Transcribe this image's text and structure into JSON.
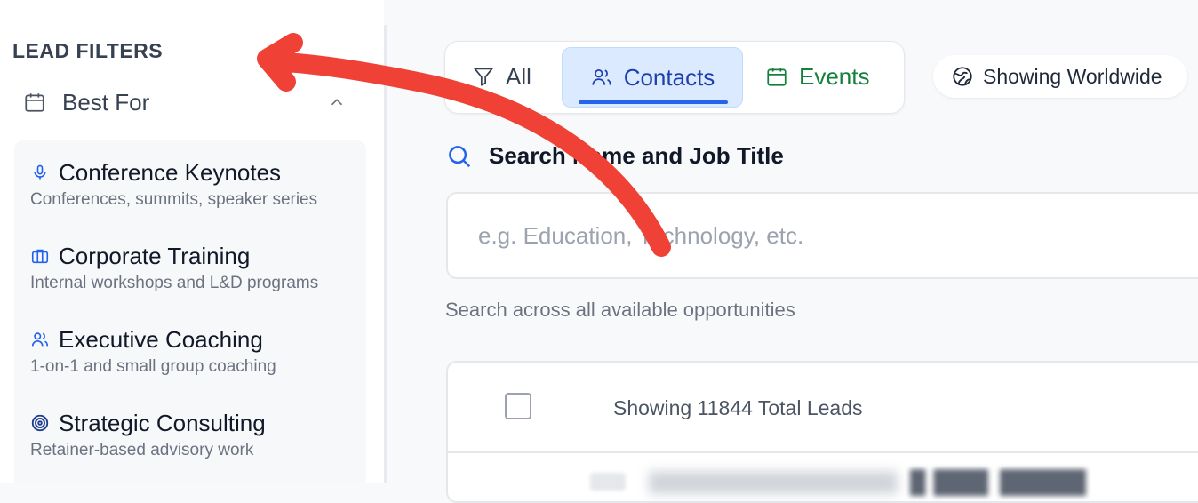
{
  "sidebar": {
    "title": "LEAD FILTERS",
    "section": {
      "label": "Best For",
      "icon": "calendar-icon",
      "toggle_icon": "chevron-up-icon"
    },
    "options": [
      {
        "icon": "microphone-icon",
        "title": "Conference Keynotes",
        "description": "Conferences, summits, speaker series"
      },
      {
        "icon": "briefcase-icon",
        "title": "Corporate Training",
        "description": "Internal workshops and L&D programs"
      },
      {
        "icon": "users-icon",
        "title": "Executive Coaching",
        "description": "1-on-1 and small group coaching"
      },
      {
        "icon": "target-icon",
        "title": "Strategic Consulting",
        "description": "Retainer-based advisory work"
      }
    ]
  },
  "tabs": {
    "all": {
      "label": "All",
      "icon": "filter-icon"
    },
    "contacts": {
      "label": "Contacts",
      "icon": "users-icon",
      "active": true
    },
    "events": {
      "label": "Events",
      "icon": "calendar-icon"
    }
  },
  "location": {
    "label": "Showing Worldwide",
    "icon": "globe-icon"
  },
  "search": {
    "heading": "Search Name and Job Title",
    "placeholder": "e.g. Education, Technology, etc.",
    "hint": "Search across all available opportunities"
  },
  "table": {
    "lead_count_label": "Showing 11844 Total Leads"
  },
  "colors": {
    "accent_blue": "#2563eb",
    "events_green": "#15803d",
    "annotation_arrow": "#ef4135"
  }
}
